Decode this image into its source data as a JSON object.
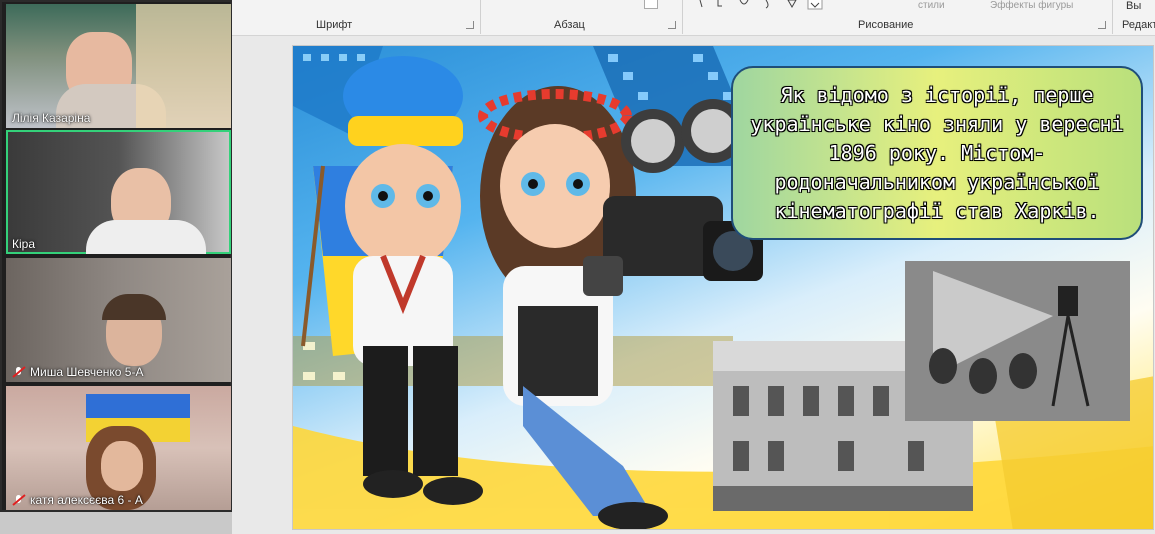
{
  "ribbon": {
    "groups": {
      "font": "Шрифт",
      "paragraph": "Абзац",
      "drawing": "Рисование",
      "editing": "Редакт"
    },
    "muted_items": {
      "styles": "стили",
      "shape_effects": "Эффекты фигуры"
    },
    "select_label": "Вы"
  },
  "slide": {
    "text": "Як відомо з історії, перше українське кіно зняли у вересні 1896 року. Містом-родоначальником української кінематографії став Харків.",
    "colors": {
      "sky": "#2b8fd8",
      "yellow": "#ffe24a",
      "box_border": "#1f4e79"
    }
  },
  "gallery": {
    "participants": [
      {
        "name": "Лілія Казаріна",
        "muted": false,
        "active": false
      },
      {
        "name": "Кіра",
        "muted": false,
        "active": true
      },
      {
        "name": "Миша Шевченко 5-А",
        "muted": true,
        "active": false
      },
      {
        "name": "катя алексєєва 6 - А",
        "muted": true,
        "active": false
      }
    ],
    "active_color": "#34d17a",
    "mute_color": "#e02020"
  }
}
